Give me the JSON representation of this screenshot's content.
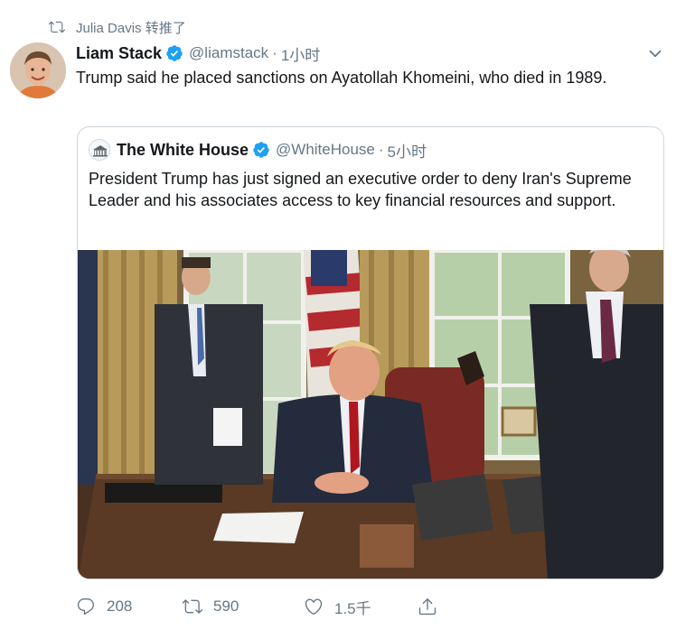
{
  "retweet": {
    "label": "Julia Davis 转推了",
    "icon": "retweet-icon"
  },
  "tweet": {
    "author_name": "Liam Stack",
    "handle": "@liamstack",
    "separator": "·",
    "time": "1小时",
    "text": "Trump said he placed sanctions on Ayatollah Khomeini, who died in 1989.",
    "verified_icon": "verified-badge-icon",
    "menu_icon": "chevron-down-icon"
  },
  "quoted": {
    "author_name": "The White House",
    "handle": "@WhiteHouse",
    "separator": "·",
    "time": "5小时",
    "text": "President Trump has just signed an executive order to deny Iran's Supreme Leader and his associates access to key financial resources and support."
  },
  "actions": {
    "reply_count": "208",
    "retweet_count": "590",
    "like_count": "1.5千"
  },
  "colors": {
    "brand_blue": "#1da1f2",
    "secondary_text": "#657786",
    "primary_text": "#14171a",
    "border": "#ccd6dd"
  }
}
